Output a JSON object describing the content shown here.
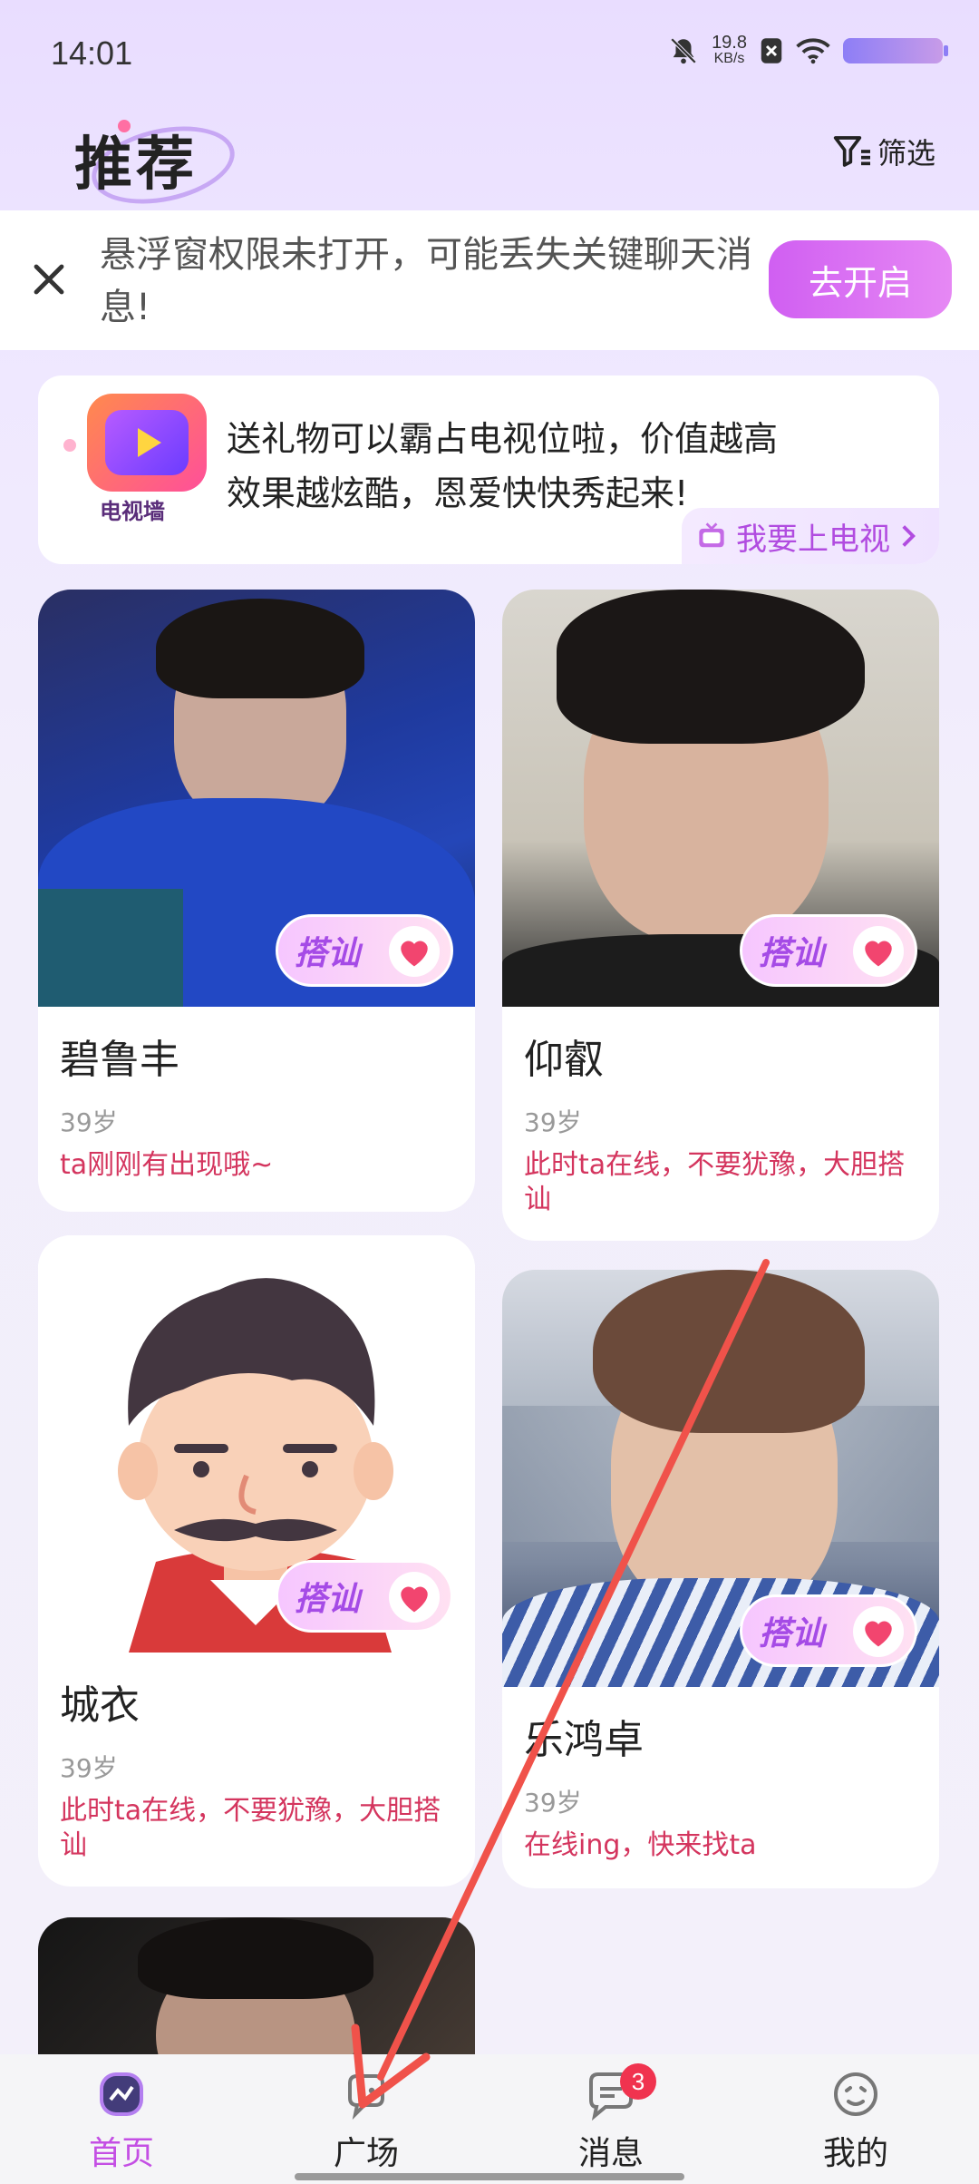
{
  "status_bar": {
    "time": "14:01",
    "net_speed_value": "19.8",
    "net_speed_unit": "KB/s",
    "icons": [
      "bell-muted-icon",
      "sim-x-icon",
      "wifi-icon",
      "battery-icon"
    ]
  },
  "header": {
    "title": "推荐",
    "filter_label": "筛选"
  },
  "permission_banner": {
    "message": "悬浮窗权限未打开，可能丢失关键聊天消息!",
    "button_label": "去开启"
  },
  "tv_banner": {
    "logo_label": "电视墙",
    "description": "送礼物可以霸占电视位啦，价值越高效果越炫酷，恩爱快快秀起来!",
    "link_label": "我要上电视"
  },
  "cards": [
    {
      "name": "碧鲁丰",
      "age": "39岁",
      "status": "ta刚刚有出现哦~",
      "greet_label": "搭讪"
    },
    {
      "name": "仰叡",
      "age": "39岁",
      "status": "此时ta在线，不要犹豫，大胆搭讪",
      "greet_label": "搭讪"
    },
    {
      "name": "城衣",
      "age": "39岁",
      "status": "此时ta在线，不要犹豫，大胆搭讪",
      "greet_label": "搭讪"
    },
    {
      "name": "乐鸿卓",
      "age": "39岁",
      "status": "在线ing，快来找ta",
      "greet_label": "搭讪"
    }
  ],
  "bottom_nav": {
    "items": [
      {
        "label": "首页",
        "icon": "home-icon",
        "active": true
      },
      {
        "label": "广场",
        "icon": "plaza-icon",
        "active": false
      },
      {
        "label": "消息",
        "icon": "message-icon",
        "active": false,
        "badge": "3"
      },
      {
        "label": "我的",
        "icon": "profile-icon",
        "active": false
      }
    ]
  },
  "colors": {
    "accent": "#c44fe4",
    "status_red": "#d4355e",
    "annotation_arrow": "#f0524a"
  }
}
